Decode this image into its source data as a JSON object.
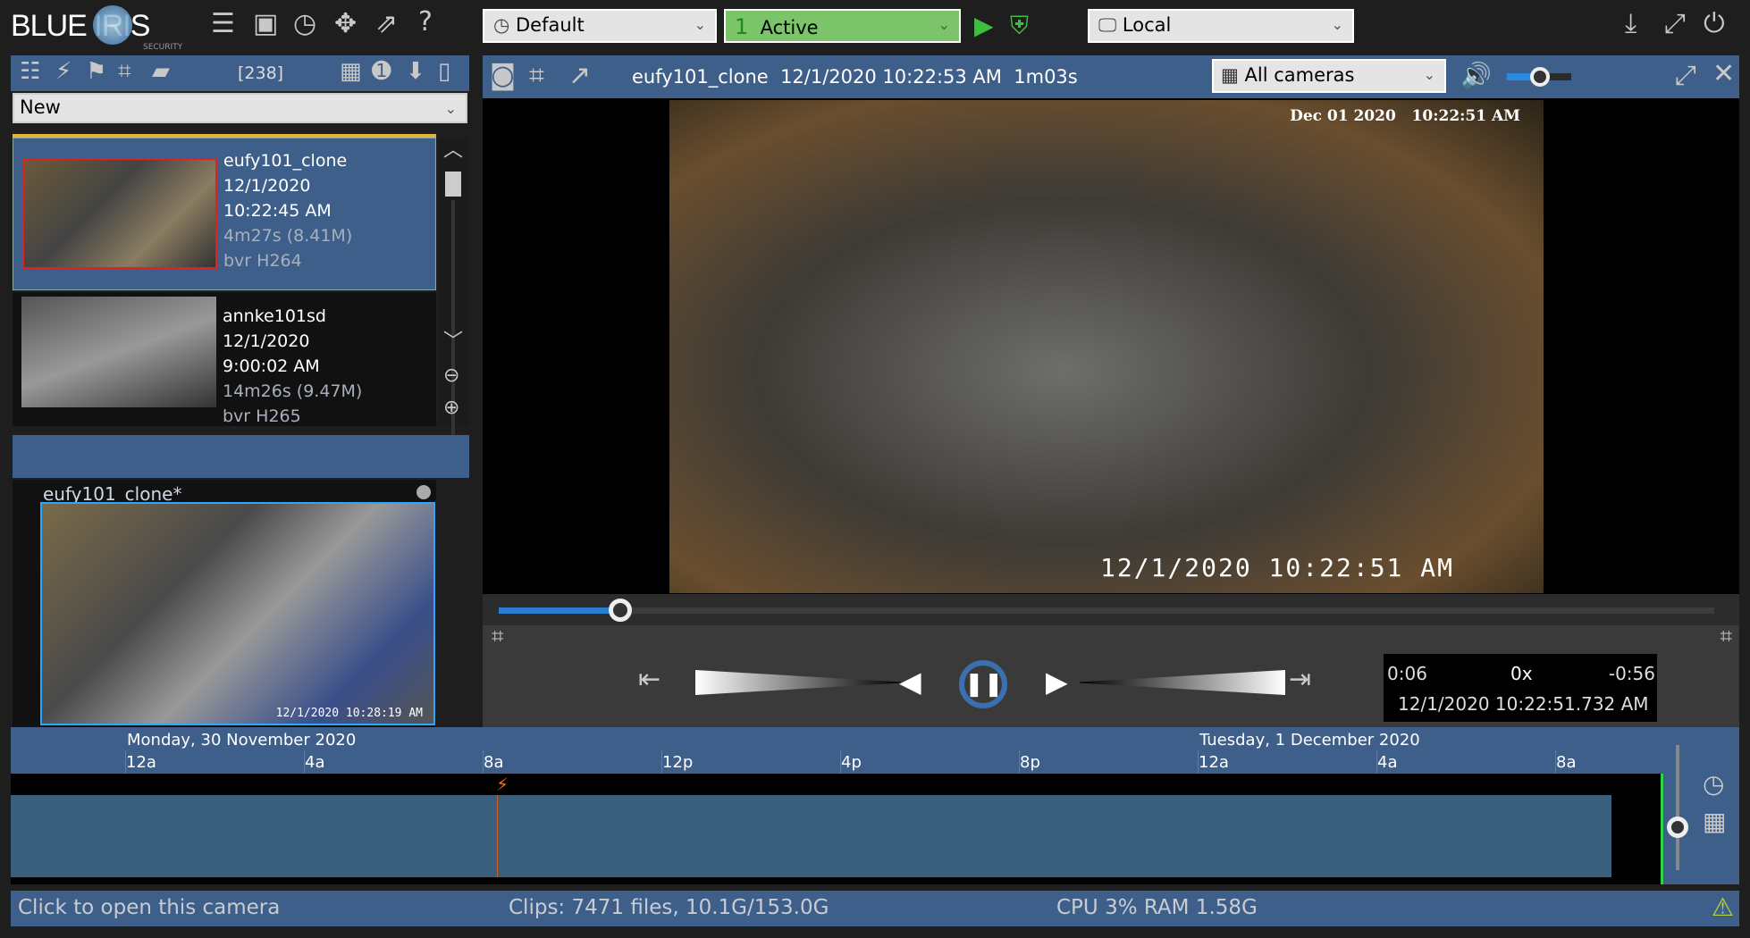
{
  "app": {
    "logo_text": "BLUE IRIS",
    "logo_sub": "SECURITY"
  },
  "toolbar": {
    "icons": [
      "list-icon",
      "clips-icon",
      "clock-icon",
      "move-icon",
      "chart-icon",
      "help-icon"
    ],
    "profile": "Default",
    "schedule_num": "1",
    "schedule": "Active",
    "connection": "Local",
    "accent_active": "#7bc46a"
  },
  "left": {
    "count": "[238]",
    "filter": "New",
    "clips": [
      {
        "camera": "eufy101_clone",
        "date": "12/1/2020",
        "time": "10:22:45 AM",
        "duration": "4m27s (8.41M)",
        "format": "bvr H264",
        "selected": true
      },
      {
        "camera": "annke101sd",
        "date": "12/1/2020",
        "time": "9:00:02 AM",
        "duration": "14m26s (9.47M)",
        "format": "bvr H265",
        "selected": false
      }
    ],
    "preview": {
      "title": "eufy101_clone*",
      "timestamp": "12/1/2020 10:28:19 AM"
    }
  },
  "viewer": {
    "title": "eufy101_clone  12/1/2020 10:22:53 AM  1m03s",
    "cameras": "All cameras",
    "overlay_top": "Dec 01 2020   10:22:51 AM",
    "overlay_bottom": "12/1/2020 10:22:51 AM",
    "seek_progress": 0.1,
    "volume": 0.5
  },
  "playback": {
    "elapsed": "0:06",
    "speed": "0x",
    "remaining": "-0:56",
    "timestamp": "12/1/2020 10:22:51.732 AM"
  },
  "timeline": {
    "day1": "Monday, 30 November 2020",
    "day2": "Tuesday, 1 December 2020",
    "ticks": [
      "12a",
      "4a",
      "8a",
      "12p",
      "4p",
      "8p",
      "12a",
      "4a",
      "8a"
    ]
  },
  "status": {
    "hint": "Click to open this camera",
    "clips": "Clips: 7471 files, 10.1G/153.0G",
    "cpu": "CPU 3% RAM 1.58G"
  }
}
